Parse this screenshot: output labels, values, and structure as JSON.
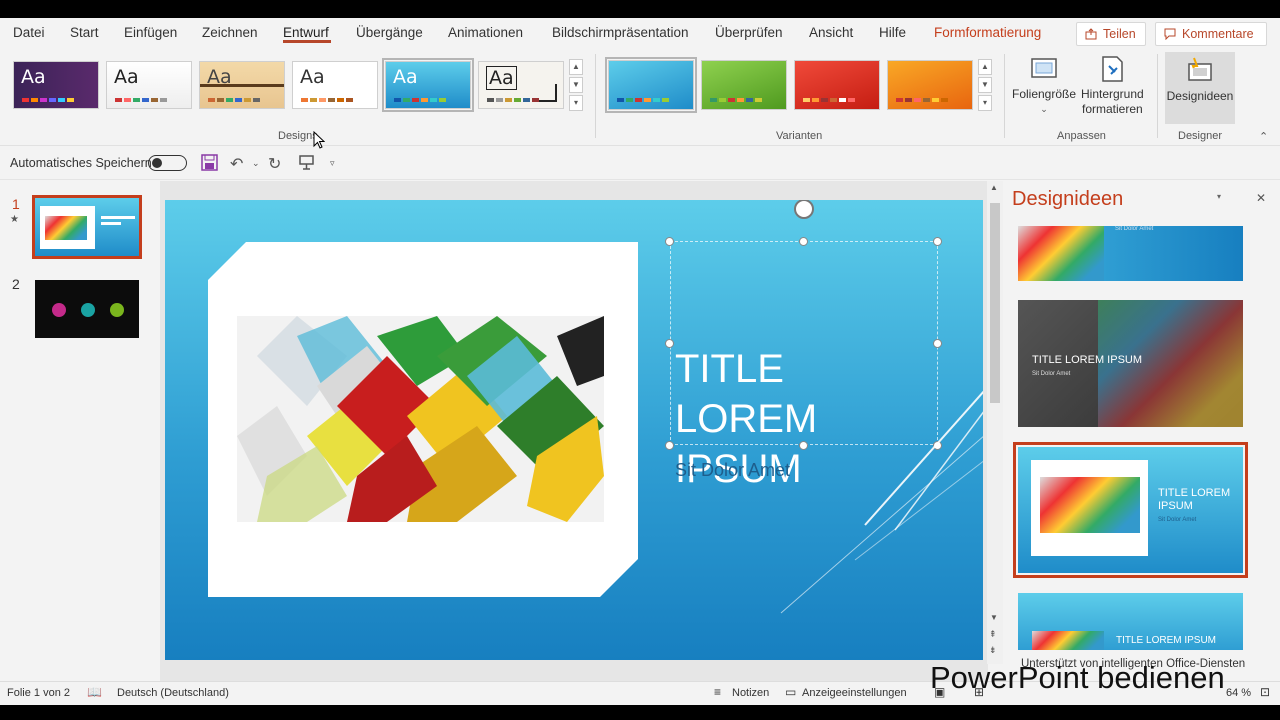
{
  "menu": {
    "tabs": [
      "Datei",
      "Start",
      "Einfügen",
      "Zeichnen",
      "Entwurf",
      "Übergänge",
      "Animationen",
      "Bildschirmpräsentation",
      "Überprüfen",
      "Ansicht",
      "Hilfe"
    ],
    "contextual_tab": "Formformatierung",
    "active_tab": "Entwurf",
    "share": "Teilen",
    "comments": "Kommentare"
  },
  "ribbon": {
    "themes_label": "Designs",
    "theme_aa": "Aa",
    "variants_label": "Varianten",
    "slide_size": "Foliengröße",
    "format_background_1": "Hintergrund",
    "format_background_2": "formatieren",
    "customize_label": "Anpassen",
    "design_ideas_btn": "Designideen",
    "designer_label": "Designer"
  },
  "qat": {
    "autosave": "Automatisches Speichern"
  },
  "thumbnails": {
    "slide1": "1",
    "slide2": "2"
  },
  "slide": {
    "title": "TITLE LOREM IPSUM",
    "subtitle": "Sit Dolor Amet"
  },
  "pane": {
    "title": "Designideen",
    "idea2_title": "TITLE LOREM IPSUM",
    "idea2_sub": "Sit Dolor Amet",
    "idea1_sub": "Sit Dolor Amet",
    "idea3_title": "TITLE LOREM IPSUM",
    "idea3_sub": "Sit Dolor Amet",
    "idea4_title": "TITLE LOREM IPSUM",
    "footer": "Unterstützt von intelligenten Office-Diensten"
  },
  "status": {
    "slide_of": "Folie 1 von 2",
    "language": "Deutsch (Deutschland)",
    "notes": "Notizen",
    "display_settings": "Anzeigeeinstellungen",
    "zoom": "64 %"
  },
  "watermark": "PowerPoint bedienen",
  "colors": {
    "accent": "#c43e1c",
    "slide_top": "#5dcdea",
    "slide_bottom": "#177fc0"
  }
}
